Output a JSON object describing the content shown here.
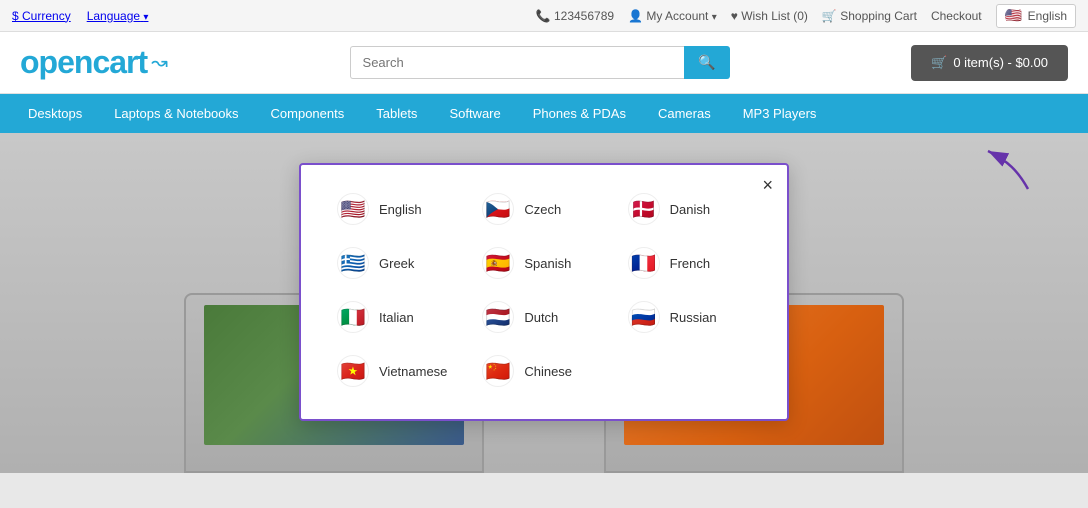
{
  "topbar": {
    "currency_label": "$ Currency",
    "language_label": "Language",
    "phone": "123456789",
    "my_account": "My Account",
    "wish_list": "Wish List (0)",
    "shopping_cart": "Shopping Cart",
    "checkout": "Checkout",
    "current_language": "English"
  },
  "header": {
    "logo_text": "opencart",
    "search_placeholder": "Search",
    "cart_label": "0 item(s) - $0.00"
  },
  "nav": {
    "items": [
      "Desktops",
      "Laptops & Notebooks",
      "Components",
      "Tablets",
      "Software",
      "Phones & PDAs",
      "Cameras",
      "MP3 Players"
    ]
  },
  "language_modal": {
    "close_label": "×",
    "languages": [
      {
        "name": "English",
        "flag": "🇺🇸"
      },
      {
        "name": "Czech",
        "flag": "🇨🇿"
      },
      {
        "name": "Danish",
        "flag": "🇩🇰"
      },
      {
        "name": "Greek",
        "flag": "🇬🇷"
      },
      {
        "name": "Spanish",
        "flag": "🇪🇸"
      },
      {
        "name": "French",
        "flag": "🇫🇷"
      },
      {
        "name": "Italian",
        "flag": "🇮🇹"
      },
      {
        "name": "Dutch",
        "flag": "🇳🇱"
      },
      {
        "name": "Russian",
        "flag": "🇷🇺"
      },
      {
        "name": "Vietnamese",
        "flag": "🇻🇳"
      },
      {
        "name": "Chinese",
        "flag": "🇨🇳"
      }
    ]
  }
}
